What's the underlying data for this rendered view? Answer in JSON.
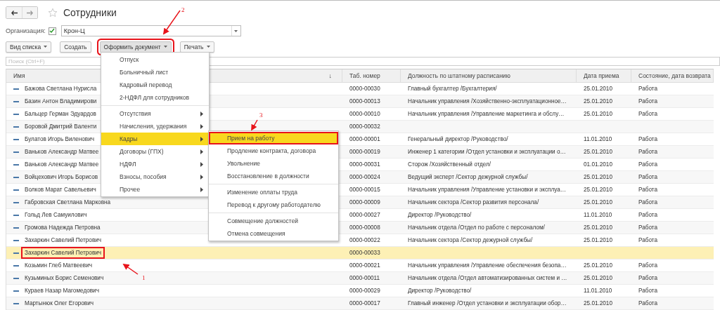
{
  "window": {
    "title": "Сотрудники",
    "favorite": false
  },
  "filter": {
    "label": "Организация:",
    "checked": true,
    "value": "Крон-Ц"
  },
  "toolbar": [
    {
      "label": "Вид списка",
      "dropdown": true,
      "pressed": false,
      "annotated": false
    },
    {
      "label": "Создать",
      "dropdown": false,
      "pressed": false,
      "annotated": false
    },
    {
      "label": "Оформить документ",
      "dropdown": true,
      "pressed": true,
      "annotated": true
    },
    {
      "label": "Печать",
      "dropdown": true,
      "pressed": false,
      "annotated": false
    }
  ],
  "search": {
    "placeholder": "Поиск (Ctrl+F)"
  },
  "table": {
    "columns": [
      {
        "label": "Имя",
        "sort_mark": "↓"
      },
      {
        "label": "Таб. номер"
      },
      {
        "label": "Должность по штатному расписанию"
      },
      {
        "label": "Дата приема"
      },
      {
        "label": "Состояние, дата возврата"
      }
    ],
    "rows": [
      {
        "name": "Бажова Светлана Нурисла",
        "number": "0000-00030",
        "position": "Главный бухгалтер /Бухгалтерия/",
        "date": "25.01.2010",
        "state": "Работа",
        "selected": false,
        "annotated": false
      },
      {
        "name": "Базин Антон Владимирови",
        "number": "0000-00013",
        "position": "Начальник управления /Хозяйственно-эксплуатационное…",
        "date": "25.01.2010",
        "state": "Работа",
        "selected": false,
        "annotated": false
      },
      {
        "name": "Бальцер Герман Эдуардов",
        "number": "0000-00010",
        "position": "Начальник управления /Управление маркетинга и обслу…",
        "date": "25.01.2010",
        "state": "Работа",
        "selected": false,
        "annotated": false
      },
      {
        "name": "Боровой Дмитрий Валенти",
        "number": "0000-00032",
        "selected": false,
        "annotated": false
      },
      {
        "name": "Булатов Игорь Виленович",
        "number": "0000-00001",
        "position": "Генеральный директор /Руководство/",
        "date": "11.01.2010",
        "state": "Работа",
        "selected": false,
        "annotated": false
      },
      {
        "name": "Ваньков Александр Матвее",
        "number": "0000-00019",
        "position": "Инженер 1 категории /Отдел установки и эксплуатации о…",
        "date": "25.01.2010",
        "state": "Работа",
        "selected": false,
        "annotated": false
      },
      {
        "name": "Ваньков Александр Матвее",
        "number": "0000-00031",
        "position": "Сторож /Хозяйственный отдел/",
        "date": "01.01.2010",
        "state": "Работа",
        "selected": false,
        "annotated": false
      },
      {
        "name": "Войцехович Игорь Борисов",
        "number": "0000-00024",
        "position": "Ведущий эксперт /Сектор дежурной службы/",
        "date": "25.01.2010",
        "state": "Работа",
        "selected": false,
        "annotated": false
      },
      {
        "name": "Волков Марат Савельевич",
        "number": "0000-00015",
        "position": "Начальник управления /Управление установки и эксплуа…",
        "date": "25.01.2010",
        "state": "Работа",
        "selected": false,
        "annotated": false
      },
      {
        "name": "Габровская Светлана Марковна",
        "number": "0000-00009",
        "position": "Начальник сектора /Сектор развития персонала/",
        "date": "25.01.2010",
        "state": "Работа",
        "selected": false,
        "annotated": false
      },
      {
        "name": "Гольд Лев Самуилович",
        "number": "0000-00027",
        "position": "Директор /Руководство/",
        "date": "11.01.2010",
        "state": "Работа",
        "selected": false,
        "annotated": false
      },
      {
        "name": "Громова Надежда Петровна",
        "number": "0000-00008",
        "position": "Начальник отдела /Отдел по работе с персоналом/",
        "date": "25.01.2010",
        "state": "Работа",
        "selected": false,
        "annotated": false
      },
      {
        "name": "Захаркин Савелий Петрович",
        "number": "0000-00022",
        "position": "Начальник сектора /Сектор дежурной службы/",
        "date": "25.01.2010",
        "state": "Работа",
        "selected": false,
        "annotated": false
      },
      {
        "name": "Захаркин Савелий Петрович",
        "number": "0000-00033",
        "selected": true,
        "annotated": true
      },
      {
        "name": "Козьмин Глеб Матвеевич",
        "number": "0000-00021",
        "position": "Начальник управления /Управление обеспечения безопа…",
        "date": "25.01.2010",
        "state": "Работа",
        "selected": false,
        "annotated": false
      },
      {
        "name": "Кузьминых Борис Семенович",
        "number": "0000-00011",
        "position": "Начальник отдела /Отдел автоматизированных систем и …",
        "date": "25.01.2010",
        "state": "Работа",
        "selected": false,
        "annotated": false
      },
      {
        "name": "Кураев Назар Магомедович",
        "number": "0000-00029",
        "position": "Директор /Руководство/",
        "date": "11.01.2010",
        "state": "Работа",
        "selected": false,
        "annotated": false
      },
      {
        "name": "Мартынюк Олег Егорович",
        "number": "0000-00017",
        "position": "Главный инженер /Отдел установки и эксплуатации обор…",
        "date": "25.01.2010",
        "state": "Работа",
        "selected": false,
        "annotated": false
      }
    ]
  },
  "menu": {
    "groups": [
      [
        {
          "label": "Отпуск",
          "kind": "item",
          "selected": false
        },
        {
          "label": "Больничный лист",
          "kind": "item",
          "selected": false
        },
        {
          "label": "Кадровый перевод",
          "kind": "item",
          "selected": false
        },
        {
          "label": "2-НДФЛ для сотрудников",
          "kind": "item",
          "selected": false
        }
      ],
      [
        {
          "label": "Отсутствия",
          "kind": "submenu",
          "selected": false
        },
        {
          "label": "Начисления, удержания",
          "kind": "submenu",
          "selected": false
        },
        {
          "label": "Кадры",
          "kind": "submenu",
          "selected": true
        },
        {
          "label": "Договоры (ГПХ)",
          "kind": "submenu",
          "selected": false
        },
        {
          "label": "НДФЛ",
          "kind": "submenu",
          "selected": false
        },
        {
          "label": "Взносы, пособия",
          "kind": "submenu",
          "selected": false
        },
        {
          "label": "Прочее",
          "kind": "submenu",
          "selected": false
        }
      ]
    ]
  },
  "submenu": {
    "groups": [
      [
        {
          "label": "Прием на работу",
          "selected": true,
          "annotated": true
        },
        {
          "label": "Продление контракта, договора",
          "selected": false,
          "annotated": false
        },
        {
          "label": "Увольнение",
          "selected": false,
          "annotated": false
        },
        {
          "label": "Восстановление в должности",
          "selected": false,
          "annotated": false
        }
      ],
      [
        {
          "label": "Изменение оплаты труда",
          "selected": false,
          "annotated": false
        },
        {
          "label": "Перевод к другому работодателю",
          "selected": false,
          "annotated": false
        }
      ],
      [
        {
          "label": "Совмещение должностей",
          "selected": false,
          "annotated": false
        },
        {
          "label": "Отмена совмещения",
          "selected": false,
          "annotated": false
        }
      ]
    ]
  },
  "annotations": [
    {
      "label": "2"
    },
    {
      "label": "3"
    },
    {
      "label": "1"
    }
  ]
}
